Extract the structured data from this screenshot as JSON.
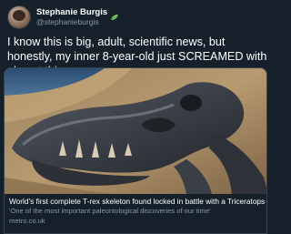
{
  "author": {
    "display_name": "Stephanie Burgis",
    "handle": "@stephanieburgis",
    "badge_icon": "leaf-icon"
  },
  "tweet": {
    "text": "I know this is big, adult, scientific news, but honestly, my inner 8-year-old just SCREAMED with glee at this news:"
  },
  "link_card": {
    "image_alt_icon": "dinosaur-skull-fossil-image",
    "title": "World's first complete T-rex skeleton found locked in battle with a Triceratops",
    "description": "'One of the most important paleontological discoveries of our time'",
    "domain": "metro.co.uk"
  },
  "colors": {
    "background": "#15202b",
    "text_primary": "#ffffff",
    "text_secondary": "#8899a6",
    "border": "#38444d",
    "leaf_accent": "#7cc46a"
  }
}
